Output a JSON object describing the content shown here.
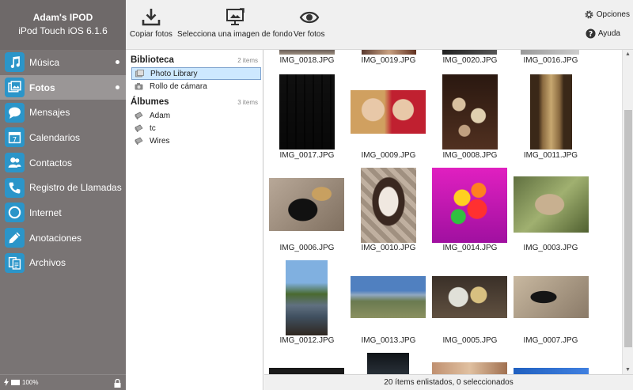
{
  "device": {
    "name": "Adam's IPOD",
    "model": "iPod Touch iOS 6.1.6"
  },
  "sidebar": {
    "items": [
      {
        "label": "Música",
        "icon": "music-icon"
      },
      {
        "label": "Fotos",
        "icon": "photos-icon"
      },
      {
        "label": "Mensajes",
        "icon": "messages-icon"
      },
      {
        "label": "Calendarios",
        "icon": "calendar-icon"
      },
      {
        "label": "Contactos",
        "icon": "contacts-icon"
      },
      {
        "label": "Registro de Llamadas",
        "icon": "phone-icon"
      },
      {
        "label": "Internet",
        "icon": "internet-icon"
      },
      {
        "label": "Anotaciones",
        "icon": "pencil-icon"
      },
      {
        "label": "Archivos",
        "icon": "files-icon"
      }
    ],
    "battery": "100%"
  },
  "toolbar": {
    "copy_label": "Copiar fotos",
    "wallpaper_label": "Selecciona una imagen de fondo",
    "view_label": "Ver fotos",
    "options_label": "Opciones",
    "help_label": "Ayuda"
  },
  "library": {
    "biblioteca": {
      "title": "Biblioteca",
      "count": "2 items",
      "items": [
        "Photo Library",
        "Rollo de cámara"
      ]
    },
    "albums": {
      "title": "Álbumes",
      "count": "3 items",
      "items": [
        "Adam",
        "tc",
        "Wires"
      ]
    }
  },
  "grid": {
    "rows": [
      [
        "IMG_0018.JPG",
        "IMG_0019.JPG",
        "IMG_0020.JPG",
        "IMG_0016.JPG"
      ],
      [
        "IMG_0017.JPG",
        "IMG_0009.JPG",
        "IMG_0008.JPG",
        "IMG_0011.JPG"
      ],
      [
        "IMG_0006.JPG",
        "IMG_0010.JPG",
        "IMG_0014.JPG",
        "IMG_0003.JPG"
      ],
      [
        "IMG_0012.JPG",
        "IMG_0013.JPG",
        "IMG_0005.JPG",
        "IMG_0007.JPG"
      ]
    ]
  },
  "status": "20 ítems enlistados, 0 seleccionados",
  "colors": {
    "sidebar": "#797474",
    "accent": "#2b95c9",
    "selection": "#cde8ff"
  }
}
